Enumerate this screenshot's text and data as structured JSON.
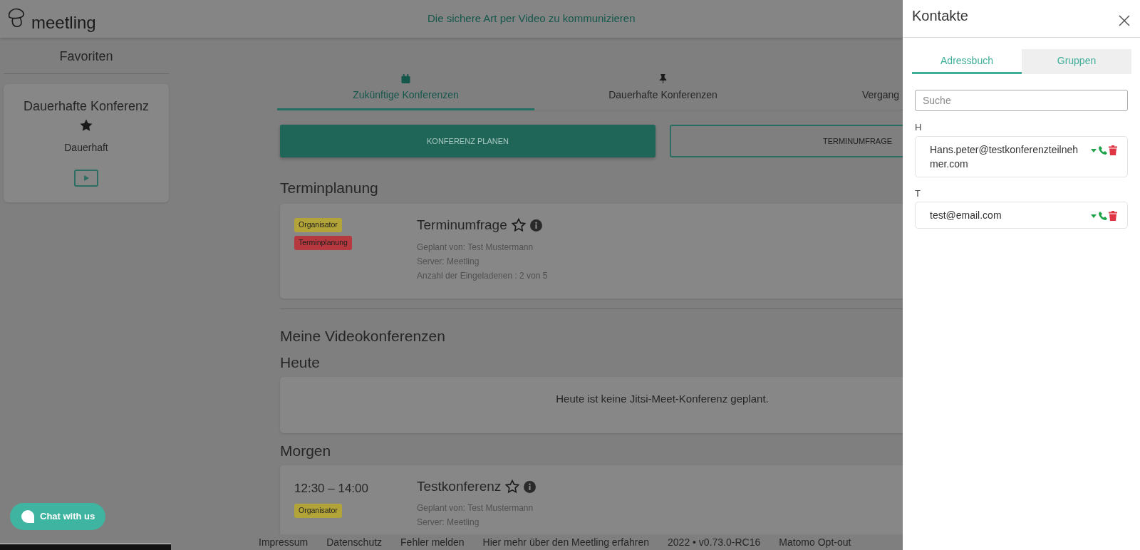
{
  "header": {
    "logo": "meetling",
    "tagline": "Die sichere Art per Video zu kommunizieren"
  },
  "sidebar": {
    "title": "Favoriten",
    "favorites": [
      {
        "title": "Dauerhafte Konferenz",
        "starred": true,
        "type": "Dauerhaft"
      }
    ]
  },
  "tabs": [
    {
      "label": "Zukünftige Konferenzen",
      "kind": "calendar",
      "selected": true
    },
    {
      "label": "Dauerhafte Konferenzen",
      "kind": "pin",
      "selected": false
    },
    {
      "label": "Vergang",
      "kind": "hidden",
      "selected": false
    }
  ],
  "actions": [
    {
      "label": "KONFERENZ PLANEN",
      "kind": "primary"
    },
    {
      "label": "TERMINUMFRAGE",
      "kind": "outline"
    }
  ],
  "scheduling": {
    "title": "Terminplanung",
    "items": [
      {
        "badges": [
          {
            "label": "Organisator",
            "color": "#b3a43a"
          },
          {
            "label": "Terminplanung",
            "color": "#b5393f"
          }
        ],
        "title": "Terminumfrage",
        "starred": false,
        "details": [
          "Geplant von: Test Mustermann",
          "Server: Meetling",
          "Anzahl der Eingeladenen : 2 von 5"
        ]
      }
    ]
  },
  "my_conferences": {
    "title": "Meine Videokonferenzen",
    "days": [
      {
        "title": "Heute",
        "empty_message": "Heute ist keine Jitsi-Meet-Konferenz geplant."
      },
      {
        "title": "Morgen",
        "items": [
          {
            "time": "12:30 – 14:00",
            "badges": [
              {
                "label": "Organisator",
                "color": "#b3a43a"
              }
            ],
            "title": "Testkonferenz",
            "starred": false,
            "details": [
              "Geplant von: Test Mustermann",
              "Server: Meetling"
            ]
          }
        ]
      }
    ]
  },
  "footer": {
    "links": [
      "Impressum",
      "Datenschutz",
      "Fehler melden",
      "Hier mehr über den Meetling erfahren",
      "2022 • v0.73.0-RC16",
      "Matomo Opt-out"
    ]
  },
  "chat": {
    "label": "Chat with us"
  },
  "contacts": {
    "title": "Kontakte",
    "tabs": [
      {
        "label": "Adressbuch",
        "selected": true
      },
      {
        "label": "Gruppen",
        "selected": false
      }
    ],
    "search": {
      "placeholder": "Suche"
    },
    "groups": [
      {
        "letter": "H",
        "contacts": [
          {
            "email": "Hans.peter@testkonferenzteilnehmer.com"
          }
        ]
      },
      {
        "letter": "T",
        "contacts": [
          {
            "email": "test@email.com"
          }
        ]
      }
    ]
  }
}
